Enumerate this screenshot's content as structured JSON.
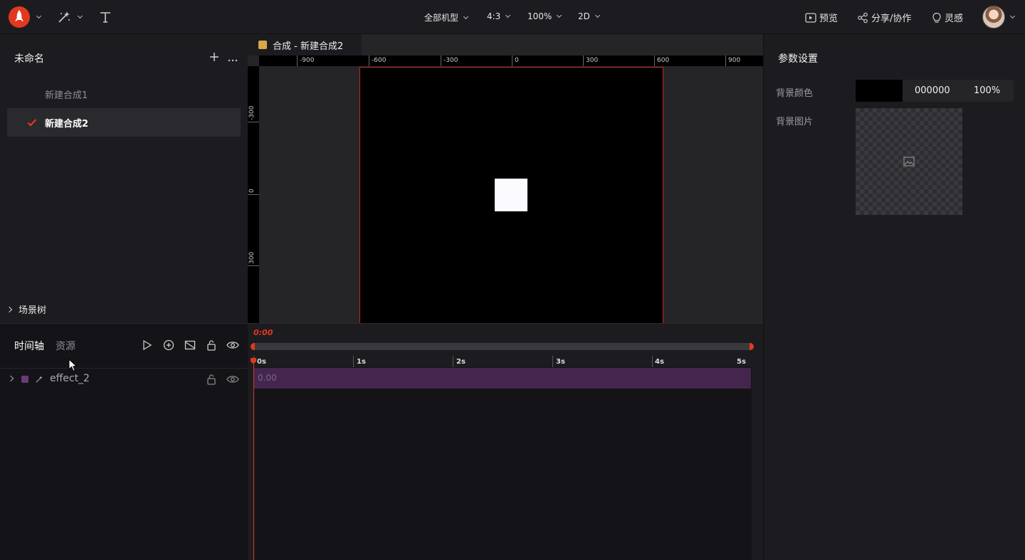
{
  "topbar": {
    "device": "全部机型",
    "ratio": "4:3",
    "zoom": "100%",
    "mode": "2D",
    "preview": "预览",
    "share": "分享/协作",
    "inspiration": "灵感"
  },
  "project": {
    "title": "未命名",
    "compositions": [
      {
        "label": "新建合成1",
        "active": false
      },
      {
        "label": "新建合成2",
        "active": true
      }
    ],
    "scene_tree": "场景树"
  },
  "canvas": {
    "tab_label": "合成 - 新建合成2",
    "tab_color": "#d7a84a",
    "ruler_h": [
      "-900",
      "-600",
      "-300",
      "0",
      "300",
      "600",
      "900"
    ],
    "ruler_v": [
      "-300",
      "0",
      "300"
    ]
  },
  "params": {
    "title": "参数设置",
    "bg_color_label": "背景颜色",
    "bg_color_value": "000000",
    "bg_opacity": "100%",
    "bg_image_label": "背景图片"
  },
  "timeline": {
    "tab_timeline": "时间轴",
    "tab_assets": "资源",
    "current_time": "0:00",
    "seconds": [
      "0s",
      "1s",
      "2s",
      "3s",
      "4s",
      "5s"
    ],
    "layers": [
      {
        "name": "effect_2",
        "clip_label": "0.00",
        "color": "#44254d"
      }
    ],
    "accent": "#e0391f"
  }
}
